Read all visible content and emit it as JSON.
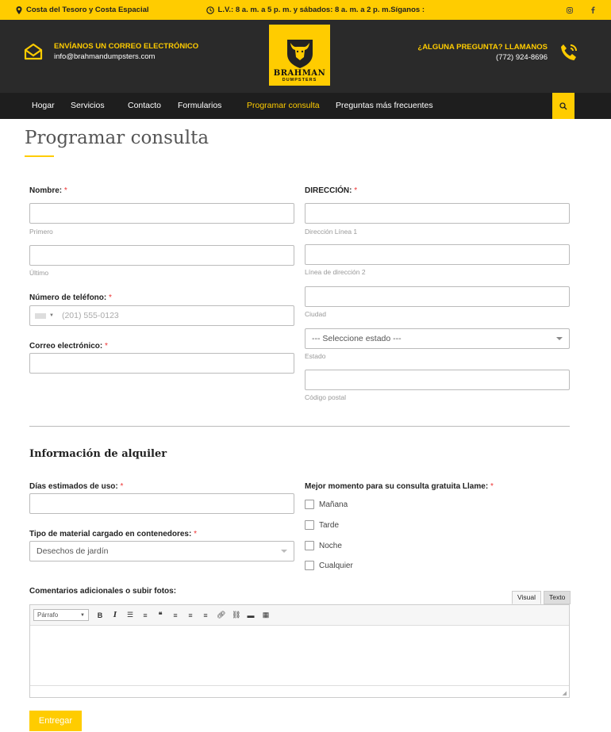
{
  "topbar": {
    "location": "Costa del Tesoro y Costa Espacial",
    "hours": "L.V.: 8 a. m. a 5 p. m. y sábados: 8 a. m. a 2 p. m.Síganos :",
    "social_icons": [
      "instagram-icon",
      "facebook-icon"
    ]
  },
  "header": {
    "email_title": "ENVÍANOS UN CORREO ELECTRÓNICO",
    "email_address": "info@brahmandumpsters.com",
    "logo_text": "BRAHMAN",
    "logo_sub": "DUMPSTERS",
    "phone_title": "¿ALGUNA PREGUNTA? LLAMANOS",
    "phone_number": "(772) 924-8696"
  },
  "nav": {
    "items": [
      "Hogar",
      "Servicios",
      "Contacto",
      "Formularios",
      "Programar consulta",
      "Preguntas más frecuentes"
    ],
    "active": "Programar consulta"
  },
  "page": {
    "title": "Programar consulta"
  },
  "form": {
    "name_label": "Nombre:",
    "first_sub": "Primero",
    "last_sub": "Último",
    "phone_label": "Número de teléfono:",
    "phone_placeholder": "(201) 555-0123",
    "email_label": "Correo electrónico:",
    "address_label": "DIRECCIÓN:",
    "addr1_sub": "Dirección Línea 1",
    "addr2_sub": "Línea de dirección 2",
    "city_sub": "Ciudad",
    "state_value": "--- Seleccione estado ---",
    "state_sub": "Estado",
    "zip_sub": "Código postal",
    "section_title": "Información de alquiler",
    "days_label": "Días estimados de uso:",
    "material_label": "Tipo de material cargado en contenedores:",
    "material_value": "Desechos de jardín",
    "best_time_label": "Mejor momento para su consulta gratuita Llame:",
    "time_options": [
      "Mañana",
      "Tarde",
      "Noche",
      "Cualquier"
    ],
    "comments_label": "Comentarios adicionales o subir fotos:",
    "tab_visual": "Visual",
    "tab_text": "Texto",
    "paragraph_select": "Párrafo",
    "required_mark": "*",
    "submit": "Entregar"
  },
  "colors": {
    "accent": "#ffcc00",
    "header_bg": "#2a2a2a",
    "nav_bg": "#1e1e1e"
  }
}
